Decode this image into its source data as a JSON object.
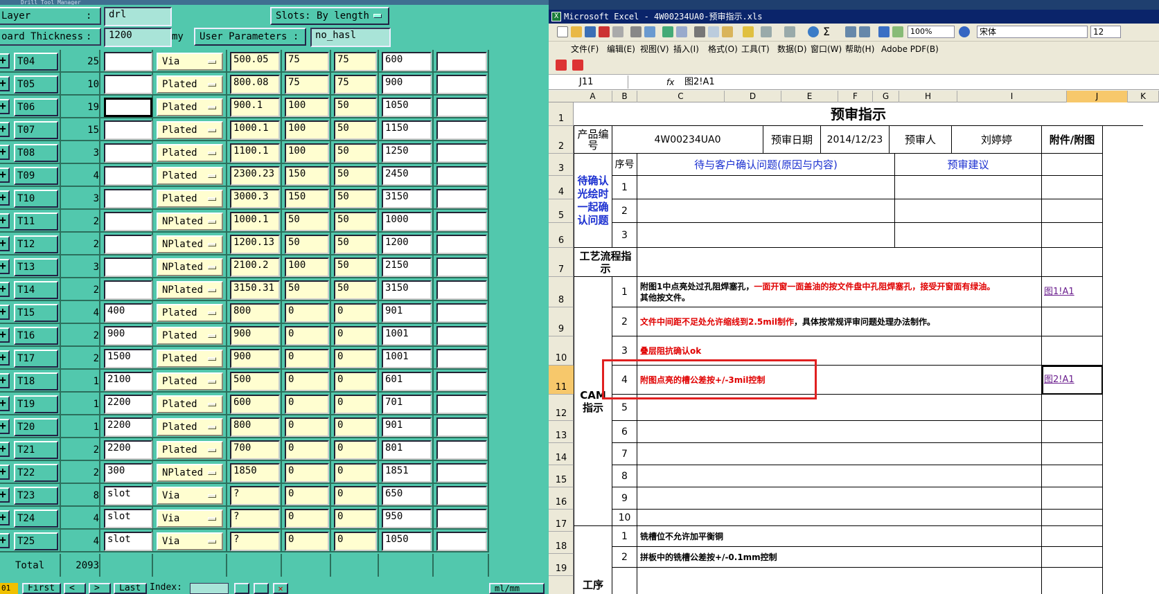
{
  "drill": {
    "window_title": "Drill Tool Manager",
    "layer_label": "Layer",
    "layer_value": "drl",
    "slots_label": "Slots:",
    "slots_value": "By length",
    "board_thickness_label": "oard Thickness",
    "board_thickness_value": "1200",
    "board_thickness_unit": "my",
    "user_params_label": "User Parameters :",
    "user_params_value": "no_hasl",
    "rows": [
      {
        "tool": "T04",
        "count": "25",
        "c1": "",
        "type": "Via",
        "d1": "500.05",
        "d2": "75",
        "d3": "75",
        "d4": "600",
        "c5": ""
      },
      {
        "tool": "T05",
        "count": "10",
        "c1": "",
        "type": "Plated",
        "d1": "800.08",
        "d2": "75",
        "d3": "75",
        "d4": "900",
        "c5": ""
      },
      {
        "tool": "T06",
        "count": "19",
        "c1": "",
        "type": "Plated",
        "d1": "900.1",
        "d2": "100",
        "d3": "50",
        "d4": "1050",
        "c5": ""
      },
      {
        "tool": "T07",
        "count": "15",
        "c1": "",
        "type": "Plated",
        "d1": "1000.1",
        "d2": "100",
        "d3": "50",
        "d4": "1150",
        "c5": ""
      },
      {
        "tool": "T08",
        "count": "3",
        "c1": "",
        "type": "Plated",
        "d1": "1100.1",
        "d2": "100",
        "d3": "50",
        "d4": "1250",
        "c5": ""
      },
      {
        "tool": "T09",
        "count": "4",
        "c1": "",
        "type": "Plated",
        "d1": "2300.23",
        "d2": "150",
        "d3": "50",
        "d4": "2450",
        "c5": ""
      },
      {
        "tool": "T10",
        "count": "3",
        "c1": "",
        "type": "Plated",
        "d1": "3000.3",
        "d2": "150",
        "d3": "50",
        "d4": "3150",
        "c5": ""
      },
      {
        "tool": "T11",
        "count": "2",
        "c1": "",
        "type": "NPlated",
        "d1": "1000.1",
        "d2": "50",
        "d3": "50",
        "d4": "1000",
        "c5": ""
      },
      {
        "tool": "T12",
        "count": "2",
        "c1": "",
        "type": "NPlated",
        "d1": "1200.13",
        "d2": "50",
        "d3": "50",
        "d4": "1200",
        "c5": ""
      },
      {
        "tool": "T13",
        "count": "3",
        "c1": "",
        "type": "NPlated",
        "d1": "2100.2",
        "d2": "100",
        "d3": "50",
        "d4": "2150",
        "c5": ""
      },
      {
        "tool": "T14",
        "count": "2",
        "c1": "",
        "type": "NPlated",
        "d1": "3150.31",
        "d2": "50",
        "d3": "50",
        "d4": "3150",
        "c5": ""
      },
      {
        "tool": "T15",
        "count": "4",
        "c1": "400",
        "type": "Plated",
        "d1": "800",
        "d2": "0",
        "d3": "0",
        "d4": "901",
        "c5": ""
      },
      {
        "tool": "T16",
        "count": "2",
        "c1": "900",
        "type": "Plated",
        "d1": "900",
        "d2": "0",
        "d3": "0",
        "d4": "1001",
        "c5": ""
      },
      {
        "tool": "T17",
        "count": "2",
        "c1": "1500",
        "type": "Plated",
        "d1": "900",
        "d2": "0",
        "d3": "0",
        "d4": "1001",
        "c5": ""
      },
      {
        "tool": "T18",
        "count": "1",
        "c1": "2100",
        "type": "Plated",
        "d1": "500",
        "d2": "0",
        "d3": "0",
        "d4": "601",
        "c5": ""
      },
      {
        "tool": "T19",
        "count": "1",
        "c1": "2200",
        "type": "Plated",
        "d1": "600",
        "d2": "0",
        "d3": "0",
        "d4": "701",
        "c5": ""
      },
      {
        "tool": "T20",
        "count": "1",
        "c1": "2200",
        "type": "Plated",
        "d1": "800",
        "d2": "0",
        "d3": "0",
        "d4": "901",
        "c5": ""
      },
      {
        "tool": "T21",
        "count": "2",
        "c1": "2200",
        "type": "Plated",
        "d1": "700",
        "d2": "0",
        "d3": "0",
        "d4": "801",
        "c5": ""
      },
      {
        "tool": "T22",
        "count": "2",
        "c1": "300",
        "type": "NPlated",
        "d1": "1850",
        "d2": "0",
        "d3": "0",
        "d4": "1851",
        "c5": ""
      },
      {
        "tool": "T23",
        "count": "8",
        "c1": "slot",
        "type": "Via",
        "d1": "?",
        "d2": "0",
        "d3": "0",
        "d4": "650",
        "c5": ""
      },
      {
        "tool": "T24",
        "count": "4",
        "c1": "slot",
        "type": "Via",
        "d1": "?",
        "d2": "0",
        "d3": "0",
        "d4": "950",
        "c5": ""
      },
      {
        "tool": "T25",
        "count": "4",
        "c1": "slot",
        "type": "Via",
        "d1": "?",
        "d2": "0",
        "d3": "0",
        "d4": "1050",
        "c5": ""
      }
    ],
    "total_label": "Total",
    "total_value": "2093",
    "bottom": {
      "page": "01",
      "first": "First",
      "last": "Last",
      "index": "Index:",
      "units": "ml/mm"
    }
  },
  "excel": {
    "title": "Microsoft Excel - 4W00234UA0-预审指示.xls",
    "zoom": "100%",
    "font_name": "宋体",
    "font_size": "12",
    "menu": [
      "文件(F)",
      "编辑(E)",
      "视图(V)",
      "插入(I)",
      "格式(O)",
      "工具(T)",
      "数据(D)",
      "窗口(W)",
      "帮助(H)",
      "Adobe PDF(B)"
    ],
    "name_box": "J11",
    "fx": "fx",
    "formula": "图2!A1",
    "columns": [
      "A",
      "B",
      "C",
      "D",
      "E",
      "F",
      "G",
      "H",
      "I",
      "J",
      "K"
    ],
    "row_numbers": [
      "1",
      "2",
      "3",
      "4",
      "5",
      "6",
      "7",
      "8",
      "9",
      "10",
      "11",
      "12",
      "13",
      "14",
      "15",
      "16",
      "17",
      "18",
      "19"
    ],
    "sheet": {
      "title": "预审指示",
      "product_label": "产品编号",
      "product_value": "4W00234UA0",
      "date_label": "预审日期",
      "date_value": "2014/12/23",
      "reviewer_label": "预审人",
      "reviewer_value": "刘婷婷",
      "attach_label": "附件/附图",
      "seq_label": "序号",
      "issue_header": "待与客户确认问题(原因与内容)",
      "suggest_header": "预审建议",
      "confirm_label": "待确认光绘时一起确认问题",
      "confirm_nums": [
        "1",
        "2",
        "3"
      ],
      "process_label": "工艺流程指示",
      "cam_label": "CAM指示",
      "cam_nums": [
        "1",
        "2",
        "3",
        "4",
        "5",
        "6",
        "7",
        "8",
        "9",
        "10"
      ],
      "cam1_black": "附图1中点亮处过孔阻焊塞孔，",
      "cam1_red": "一面开窗一面盖油的按文件盘中孔阻焊塞孔，接受开窗面有绿油。",
      "cam1_tail": "其他按文件。",
      "cam1_link": "图1!A1",
      "cam2_red": "文件中间距不足处允许缩线到2.5mil制作",
      "cam2_black": "，具体按常规评审问题处理办法制作。",
      "cam3_red": "叠层阻抗确认ok",
      "cam4_red": "附图点亮的槽公差按+/-3mil控制",
      "cam4_link": "图2!A1",
      "proc_label": "工序",
      "proc_nums": [
        "1",
        "2"
      ],
      "proc1": "铣槽位不允许加平衡铜",
      "proc2": "拼板中的铣槽公差按+/-0.1mm控制"
    }
  }
}
